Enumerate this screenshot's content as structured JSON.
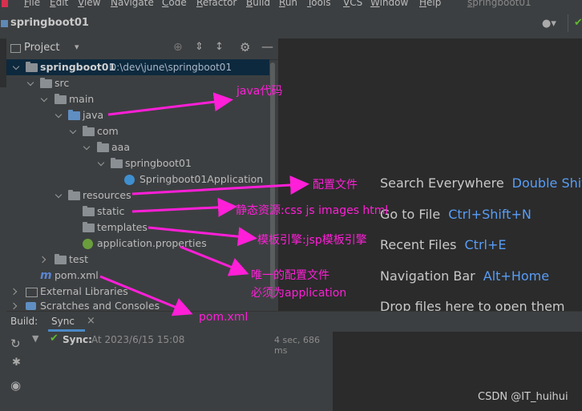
{
  "colors": {
    "accent_key": "#589df6",
    "annotation": "#ff1fd8",
    "success": "#5fb832"
  },
  "menu": [
    "File",
    "Edit",
    "View",
    "Navigate",
    "Code",
    "Refactor",
    "Build",
    "Run",
    "Tools",
    "VCS",
    "Window",
    "Help"
  ],
  "window_title": "springboot01",
  "breadcrumb": "springboot01",
  "project_panel": {
    "title": "Project"
  },
  "tree": {
    "root_name": "springboot01",
    "root_path": "D:\\dev\\june\\springboot01",
    "src": "src",
    "main": "main",
    "java": "java",
    "com": "com",
    "aaa": "aaa",
    "pkg": "springboot01",
    "app_class": "Springboot01Application",
    "resources": "resources",
    "static": "static",
    "templates": "templates",
    "app_props": "application.properties",
    "test": "test",
    "pom": "pom.xml",
    "ext_libs": "External Libraries",
    "scratches": "Scratches and Consoles"
  },
  "editor_hints": [
    {
      "label": "Search Everywhere",
      "key": "Double Shift"
    },
    {
      "label": "Go to File",
      "key": "Ctrl+Shift+N"
    },
    {
      "label": "Recent Files",
      "key": "Ctrl+E"
    },
    {
      "label": "Navigation Bar",
      "key": "Alt+Home"
    },
    {
      "label": "Drop files here to open them",
      "key": ""
    }
  ],
  "build": {
    "label": "Build:",
    "tab": "Sync",
    "sync_label": "Sync:",
    "sync_time": "At 2023/6/15 15:08",
    "duration": "4 sec, 686 ms"
  },
  "annotations": {
    "java_code": "java代码",
    "config_file": "配置文件",
    "static_res": "静态资源:css js images html",
    "template_engine": "模板引擎:jsp模板引擎",
    "unique_config": "唯一的配置文件",
    "must_be_app": "必须为application",
    "pom": "pom.xml"
  },
  "watermark": "CSDN @IT_huihui"
}
